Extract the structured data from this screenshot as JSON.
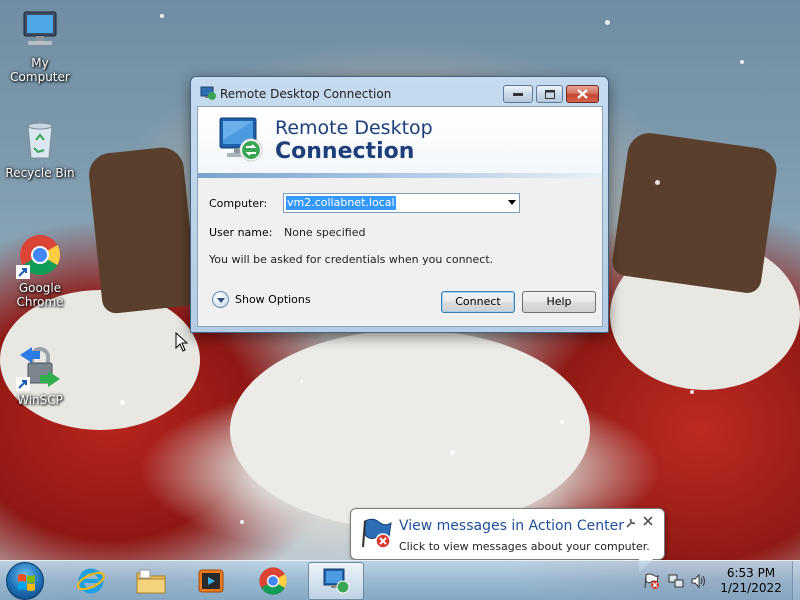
{
  "desktop": {
    "icons": [
      {
        "label": "My Computer",
        "icon": "computer-icon"
      },
      {
        "label": "Recycle Bin",
        "icon": "recycle-bin-icon"
      },
      {
        "label": "Google Chrome",
        "icon": "chrome-icon"
      },
      {
        "label": "WinSCP",
        "icon": "winscp-icon"
      }
    ]
  },
  "window": {
    "title": "Remote Desktop Connection",
    "banner_line1": "Remote Desktop",
    "banner_line2": "Connection",
    "computer_label": "Computer:",
    "computer_value": "vm2.collabnet.local",
    "username_label": "User name:",
    "username_value": "None specified",
    "info_text": "You will be asked for credentials when you connect.",
    "show_options": "Show Options",
    "connect_label": "Connect",
    "help_label": "Help"
  },
  "balloon": {
    "title": "View messages in Action Center",
    "text": "Click to view messages about your computer."
  },
  "taskbar": {
    "apps": [
      {
        "name": "internet-explorer-icon"
      },
      {
        "name": "file-explorer-icon"
      },
      {
        "name": "media-player-icon"
      },
      {
        "name": "chrome-icon"
      },
      {
        "name": "remote-desktop-icon",
        "active": true
      }
    ],
    "time": "6:53 PM",
    "date": "1/21/2022"
  },
  "colors": {
    "accent": "#1e3e7a",
    "selection": "#3399ff",
    "balloon_title": "#1f4e9c"
  }
}
